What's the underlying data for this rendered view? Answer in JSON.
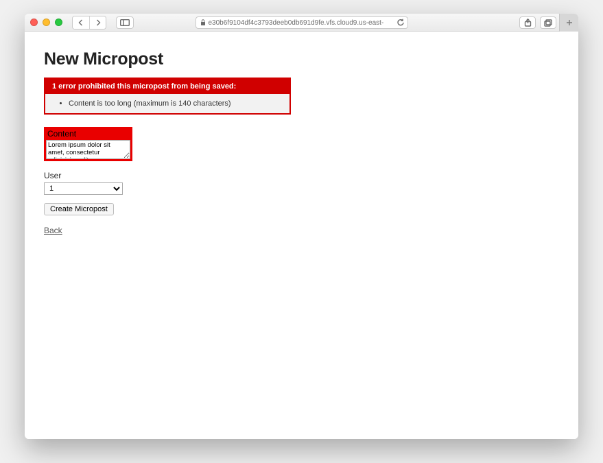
{
  "browser": {
    "address": "e30b6f9104df4c3793deeb0db691d9fe.vfs.cloud9.us-east-"
  },
  "page": {
    "title": "New Micropost",
    "error": {
      "heading": "1 error prohibited this micropost from being saved:",
      "messages": [
        "Content is too long (maximum is 140 characters)"
      ]
    },
    "form": {
      "content_label": "Content",
      "content_value": "Lorem ipsum dolor sit amet, consectetur adipisicing elit,",
      "user_label": "User",
      "user_value": "1",
      "submit_label": "Create Micropost"
    },
    "back_label": "Back"
  }
}
